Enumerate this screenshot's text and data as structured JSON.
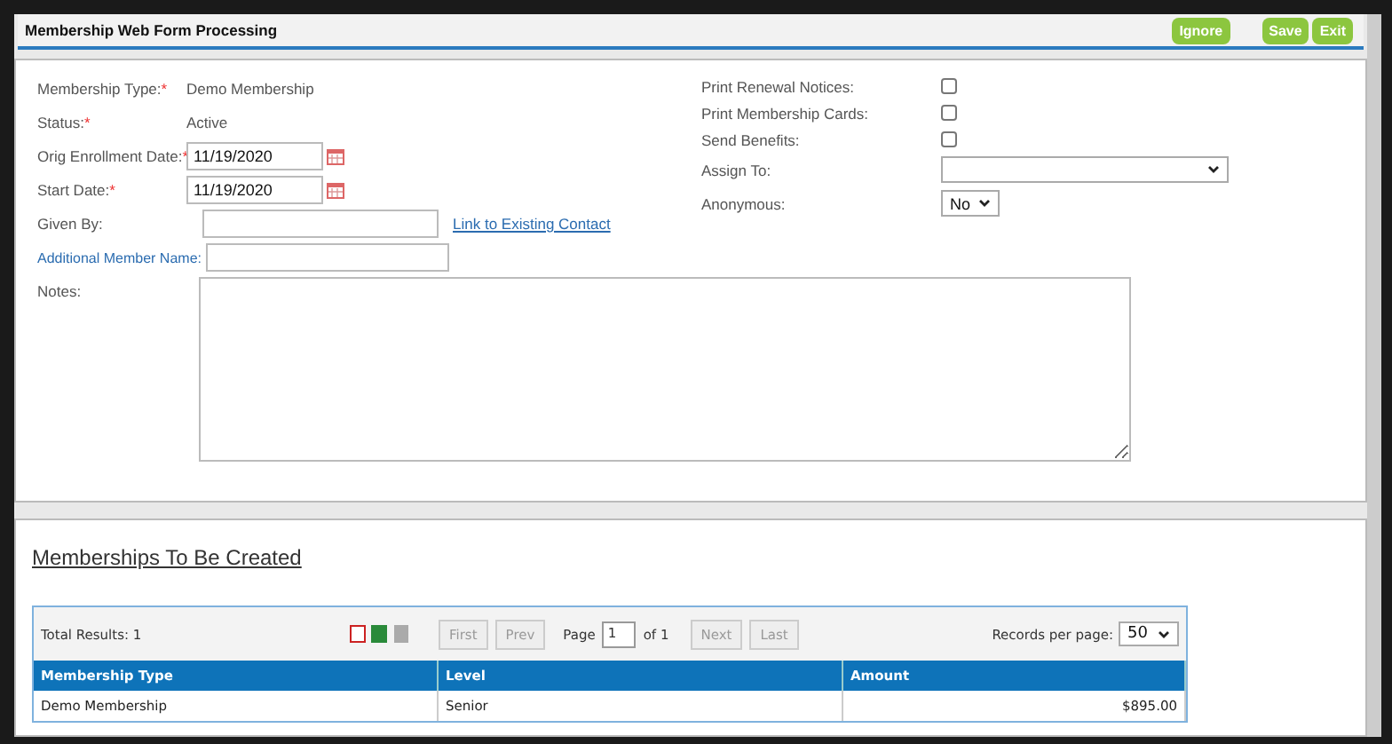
{
  "header": {
    "title": "Membership Web Form Processing",
    "buttons": [
      {
        "label": "Ignore"
      },
      {
        "label": "Save"
      },
      {
        "label": "Exit"
      }
    ]
  },
  "left_fields": [
    {
      "kind": "text",
      "label": "Membership Type:",
      "required_mark": "*",
      "value": "Demo Membership"
    },
    {
      "kind": "text",
      "label": "Status:",
      "required_mark": "*",
      "value": "Active"
    },
    {
      "kind": "date",
      "label": "Orig Enrollment Date:",
      "required_mark": "*",
      "value": "11/19/2020"
    },
    {
      "kind": "date",
      "label": "Start Date:",
      "required_mark": "*",
      "value": "11/19/2020"
    },
    {
      "kind": "input",
      "label": "Given By:",
      "link": "Link to Existing Contact"
    },
    {
      "kind": "link_label",
      "label": "Additional Member Name:"
    }
  ],
  "notes_label": "Notes:",
  "right_fields": [
    {
      "kind": "checkbox",
      "label": "Print Renewal Notices:",
      "checked": false
    },
    {
      "kind": "checkbox",
      "label": "Print Membership Cards:",
      "checked": false
    },
    {
      "kind": "checkbox",
      "label": "Send Benefits:",
      "checked": false
    },
    {
      "kind": "select",
      "label": "Assign To:"
    },
    {
      "kind": "small_select",
      "label": "Anonymous:",
      "value": "No"
    }
  ],
  "section_title": "Memberships To Be Created",
  "grid": {
    "total": "Total Results: 1",
    "pager": [
      "First",
      "Prev"
    ],
    "page_label": "Page",
    "page": "1",
    "of": "of 1",
    "pager_after": [
      "Next",
      "Last"
    ],
    "per_page_label": "Records per page:",
    "per_page": "50",
    "columns": [
      "Membership Type",
      "Level",
      "Amount"
    ],
    "rows": [
      [
        "Demo Membership",
        "Senior",
        "$895.00"
      ]
    ]
  }
}
